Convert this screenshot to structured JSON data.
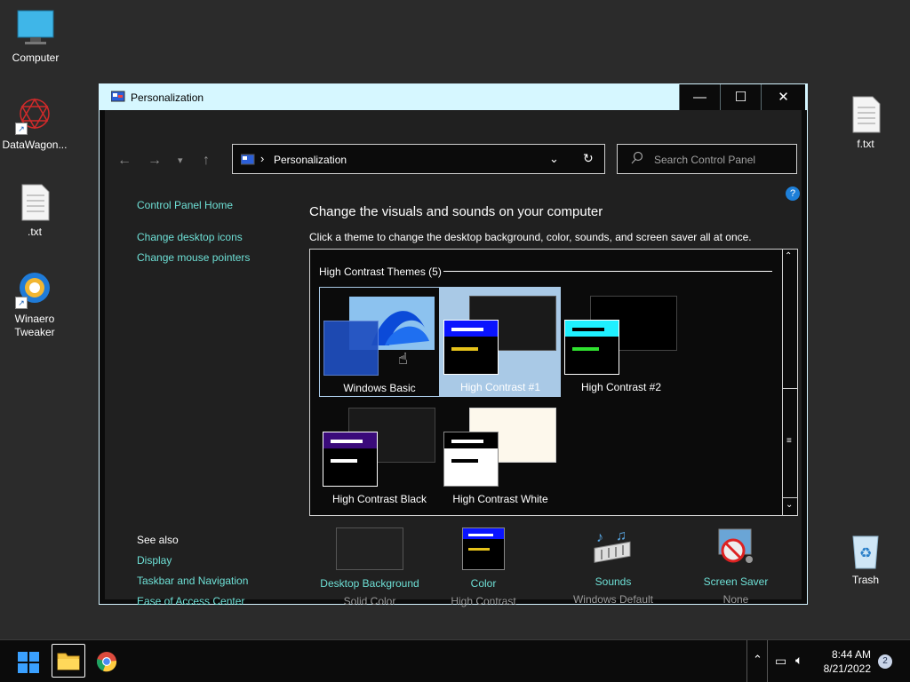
{
  "desktop": {
    "icons": [
      {
        "label": "Computer"
      },
      {
        "label": "DataWagon..."
      },
      {
        "label": ".txt"
      },
      {
        "label": "Winaero Tweaker"
      },
      {
        "label": "f.txt"
      },
      {
        "label": "Trash"
      }
    ]
  },
  "window": {
    "title": "Personalization",
    "address": "Personalization",
    "search_placeholder": "Search Control Panel",
    "controls": {
      "minimize": "—",
      "maximize": "☐",
      "close": "✕"
    }
  },
  "sidebar": {
    "home": "Control Panel Home",
    "links": [
      "Change desktop icons",
      "Change mouse pointers"
    ],
    "see_also_label": "See also",
    "see_also": [
      "Display",
      "Taskbar and Navigation",
      "Ease of Access Center"
    ]
  },
  "main": {
    "heading": "Change the visuals and sounds on your computer",
    "subheading": "Click a theme to change the desktop background, color, sounds, and screen saver all at once.",
    "group_title": "High Contrast Themes (5)",
    "themes": [
      {
        "label": "Windows Basic",
        "state": "hover-selected"
      },
      {
        "label": "High Contrast #1",
        "state": "selected"
      },
      {
        "label": "High Contrast #2",
        "state": "normal"
      },
      {
        "label": "High Contrast Black",
        "state": "normal"
      },
      {
        "label": "High Contrast White",
        "state": "normal"
      }
    ]
  },
  "bottom_bar": [
    {
      "caption": "Desktop Background",
      "value": "Solid Color"
    },
    {
      "caption": "Color",
      "value": "High Contrast"
    },
    {
      "caption": "Sounds",
      "value": "Windows Default"
    },
    {
      "caption": "Screen Saver",
      "value": "None"
    }
  ],
  "taskbar": {
    "time": "8:44 AM",
    "date": "8/21/2022",
    "notification_count": "2",
    "pinned": [
      "start-icon",
      "file-explorer-icon",
      "chrome-icon"
    ]
  },
  "colors": {
    "link": "#6ee0d6",
    "titlebar": "#d6f7ff",
    "selection": "#a9c9e6",
    "accent_blue": "#0a14ff"
  }
}
